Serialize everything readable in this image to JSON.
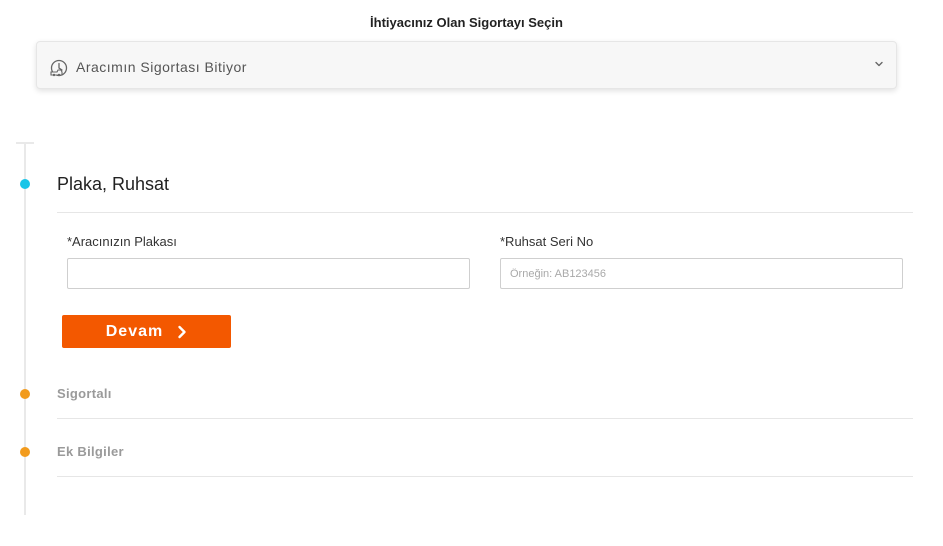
{
  "heading": "İhtiyacınız Olan Sigortayı Seçin",
  "insurance_select": {
    "selected": "Aracımın Sigortası Bitiyor",
    "icon": "car-clock-icon"
  },
  "steps": [
    {
      "title": "Plaka, Ruhsat",
      "state": "active"
    },
    {
      "title": "Sigortalı",
      "state": "pending"
    },
    {
      "title": "Ek Bilgiler",
      "state": "pending"
    }
  ],
  "form": {
    "plate_label": "*Aracınızın Plakası",
    "plate_value": "",
    "license_label": "*Ruhsat Seri No",
    "license_value": "",
    "license_placeholder": "Örneğin: AB123456"
  },
  "continue_button": {
    "label": "Devam"
  },
  "colors": {
    "active_dot": "#18c5e8",
    "pending_dot": "#f29b1d",
    "button": "#f35800"
  }
}
